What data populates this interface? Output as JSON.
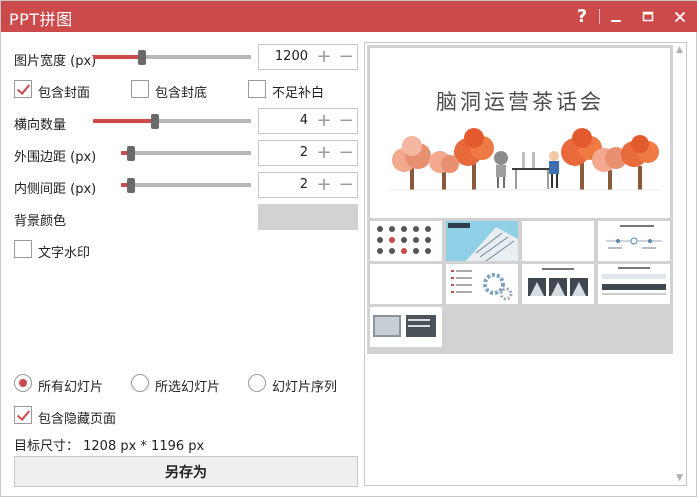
{
  "window": {
    "title": "PPT拼图",
    "help_label": "?",
    "minimize_label": "—",
    "maximize_label": "☐",
    "close_label": "✕",
    "accent_color": "#cd4a4a"
  },
  "settings": {
    "image_width": {
      "label": "图片宽度 (px)",
      "value": "1200",
      "slider_fraction": 0.31
    },
    "include_cover": {
      "label": "包含封面",
      "checked": true
    },
    "include_back": {
      "label": "包含封底",
      "checked": false
    },
    "fill_blank": {
      "label": "不足补白",
      "checked": false
    },
    "columns": {
      "label": "横向数量",
      "value": "4",
      "slider_fraction": 0.39
    },
    "outer_margin": {
      "label": "外围边距 (px)",
      "value": "2",
      "slider_fraction": 0.08
    },
    "inner_spacing": {
      "label": "内侧间距 (px)",
      "value": "2",
      "slider_fraction": 0.08
    },
    "background_color": {
      "label": "背景颜色",
      "color": "#d2d2d2"
    },
    "text_watermark": {
      "label": "文字水印",
      "checked": false
    }
  },
  "scope": {
    "all_slides": {
      "label": "所有幻灯片",
      "selected": true
    },
    "selected_slides": {
      "label": "所选幻灯片",
      "selected": false
    },
    "slide_sequence": {
      "label": "幻灯片序列",
      "selected": false
    },
    "include_hidden": {
      "label": "包含隐藏页面",
      "checked": true
    }
  },
  "target_size": "目标尺寸： 1208 px *  1196 px",
  "save_as_label": "另存为",
  "preview": {
    "cover_title": "脑洞运营茶话会",
    "thumbnail_count": 9,
    "scroll_up_icon": "▲",
    "scroll_down_icon": "▼"
  }
}
